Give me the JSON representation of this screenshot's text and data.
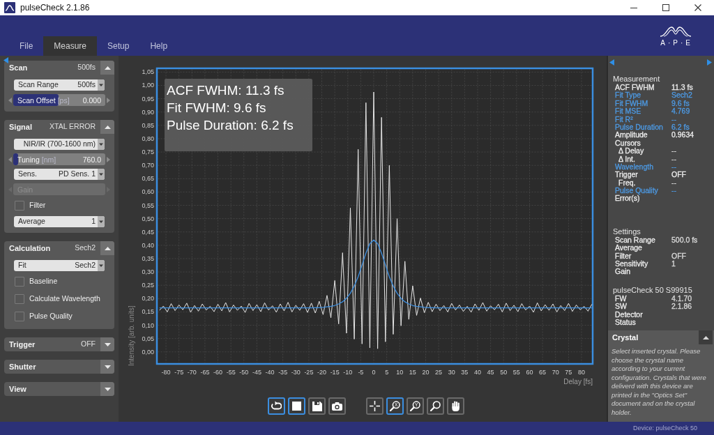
{
  "window": {
    "title": "pulseCheck 2.1.86"
  },
  "menu": [
    {
      "label": "File",
      "selected": false
    },
    {
      "label": "Measure",
      "selected": true
    },
    {
      "label": "Setup",
      "selected": false
    },
    {
      "label": "Help",
      "selected": false
    }
  ],
  "logo": {
    "text": "A·P·E"
  },
  "left_panel": {
    "sections": [
      {
        "title": "Scan",
        "value": "500fs",
        "expanded": true,
        "controls": [
          {
            "kind": "dropdown",
            "label": "Scan Range",
            "value": "500fs"
          },
          {
            "kind": "slider",
            "label": "Scan Offset",
            "unit": "[ps]",
            "value": "0.000",
            "level": 0.49,
            "disabled": false
          }
        ]
      },
      {
        "title": "Signal",
        "value": "XTAL ERROR",
        "expanded": true,
        "controls": [
          {
            "kind": "dropdown",
            "value": "NIR/IR (700-1600 nm)"
          },
          {
            "kind": "slider",
            "label": "Tuning",
            "unit": "[nm]",
            "value": "760.0",
            "level": 0.05,
            "disabled": false
          },
          {
            "kind": "dropdown",
            "label": "Sens.",
            "value": "PD Sens. 1"
          },
          {
            "kind": "slider",
            "label": "Gain",
            "disabled": true
          },
          {
            "kind": "checkbox",
            "label": "Filter",
            "checked": false
          },
          {
            "kind": "dropdown",
            "label": "Average",
            "value": "1"
          }
        ]
      },
      {
        "title": "Calculation",
        "value": "Sech2",
        "expanded": true,
        "controls": [
          {
            "kind": "dropdown",
            "label": "Fit",
            "value": "Sech2"
          },
          {
            "kind": "checkbox",
            "label": "Baseline",
            "checked": false
          },
          {
            "kind": "checkbox",
            "label": "Calculate Wavelength",
            "checked": false
          },
          {
            "kind": "checkbox",
            "label": "Pulse Quality",
            "checked": false
          }
        ]
      },
      {
        "title": "Trigger",
        "value": "OFF",
        "expanded": false
      },
      {
        "title": "Shutter",
        "expanded": false
      },
      {
        "title": "View",
        "expanded": false
      }
    ]
  },
  "plot": {
    "overlay": [
      "ACF FWHM: 11.3 fs",
      "Fit FWHM: 9.6 fs",
      "Pulse Duration: 6.2 fs"
    ],
    "chart_data": {
      "type": "line",
      "xlabel": "Delay [fs]",
      "ylabel": "Intensity [arb. units]",
      "grid": true,
      "xlim": [
        -83.5,
        84.3
      ],
      "ylim": [
        -0.045,
        1.064
      ],
      "xticks": [
        -80,
        -75,
        -70,
        -65,
        -60,
        -55,
        -50,
        -45,
        -40,
        -35,
        -30,
        -25,
        -20,
        -15,
        -10,
        -5,
        0,
        5,
        10,
        15,
        20,
        25,
        30,
        35,
        40,
        45,
        50,
        55,
        60,
        65,
        70,
        75,
        80
      ],
      "yticks": [
        {
          "value": 0,
          "label": "0,00"
        },
        {
          "value": 0.05,
          "label": "0,05"
        },
        {
          "value": 0.1,
          "label": "0,10"
        },
        {
          "value": 0.15,
          "label": "0,15"
        },
        {
          "value": 0.2,
          "label": "0,20"
        },
        {
          "value": 0.25,
          "label": "0,25"
        },
        {
          "value": 0.3,
          "label": "0,30"
        },
        {
          "value": 0.35,
          "label": "0,35"
        },
        {
          "value": 0.4,
          "label": "0,40"
        },
        {
          "value": 0.45,
          "label": "0,45"
        },
        {
          "value": 0.5,
          "label": "0,50"
        },
        {
          "value": 0.55,
          "label": "0,55"
        },
        {
          "value": 0.6,
          "label": "0,60"
        },
        {
          "value": 0.65,
          "label": "0,65"
        },
        {
          "value": 0.7,
          "label": "0,70"
        },
        {
          "value": 0.75,
          "label": "0,75"
        },
        {
          "value": 0.8,
          "label": "0,80"
        },
        {
          "value": 0.85,
          "label": "0,85"
        },
        {
          "value": 0.9,
          "label": "0,90"
        },
        {
          "value": 0.95,
          "label": "0,95"
        },
        {
          "value": 1,
          "label": "1,00"
        },
        {
          "value": 1.05,
          "label": "1,05"
        }
      ],
      "x": [
        -82.5,
        -81,
        -79.5,
        -78,
        -76.5,
        -75,
        -73.5,
        -72,
        -70.5,
        -69,
        -67.5,
        -66,
        -64.5,
        -63,
        -61.5,
        -60,
        -58.5,
        -57,
        -55.5,
        -54,
        -52.5,
        -51,
        -49.5,
        -48,
        -46.5,
        -45,
        -43.5,
        -42,
        -40.5,
        -39,
        -37.5,
        -36,
        -34.5,
        -33,
        -31.5,
        -30,
        -28.5,
        -27,
        -25.5,
        -24,
        -22.5,
        -21,
        -19.5,
        -18,
        -16.5,
        -15,
        -13.5,
        -12,
        -10.5,
        -9,
        -7.5,
        -6,
        -4.5,
        -3,
        -1.5,
        0,
        1.5,
        3,
        4.5,
        6,
        7.5,
        9,
        10.5,
        12,
        13.5,
        15,
        16.5,
        18,
        19.5,
        21,
        22.5,
        24,
        25.5,
        27,
        28.5,
        30,
        31.5,
        33,
        34.5,
        36,
        37.5,
        39,
        40.5,
        42,
        43.5,
        45,
        46.5,
        48,
        49.5,
        51,
        52.5,
        54,
        55.5,
        57,
        58.5,
        60,
        61.5,
        63,
        64.5,
        66,
        67.5,
        69,
        70.5,
        72,
        73.5,
        75,
        76.5,
        78,
        79.5,
        81,
        82.5,
        84
      ],
      "series": [
        {
          "color": "#e6e6e6",
          "values": [
            0.156,
            0.172,
            0.15,
            0.181,
            0.155,
            0.176,
            0.158,
            0.183,
            0.149,
            0.174,
            0.153,
            0.18,
            0.157,
            0.171,
            0.151,
            0.179,
            0.154,
            0.185,
            0.15,
            0.176,
            0.156,
            0.172,
            0.148,
            0.182,
            0.155,
            0.177,
            0.151,
            0.184,
            0.157,
            0.173,
            0.149,
            0.18,
            0.154,
            0.186,
            0.15,
            0.175,
            0.156,
            0.181,
            0.148,
            0.183,
            0.146,
            0.19,
            0.14,
            0.212,
            0.128,
            0.268,
            0.105,
            0.372,
            0.07,
            0.54,
            0.048,
            0.76,
            0.03,
            0.935,
            0.015,
            0.975,
            0.012,
            0.88,
            0.038,
            0.7,
            0.066,
            0.5,
            0.098,
            0.34,
            0.122,
            0.248,
            0.137,
            0.202,
            0.147,
            0.186,
            0.151,
            0.179,
            0.155,
            0.174,
            0.15,
            0.182,
            0.157,
            0.176,
            0.152,
            0.171,
            0.149,
            0.18,
            0.156,
            0.185,
            0.153,
            0.173,
            0.158,
            0.179,
            0.15,
            0.183,
            0.155,
            0.175,
            0.151,
            0.181,
            0.157,
            0.172,
            0.149,
            0.184,
            0.154,
            0.177,
            0.156,
            0.18,
            0.15,
            0.174,
            0.155,
            0.182,
            0.152,
            0.176,
            0.158,
            0.171,
            0.153,
            0.179
          ]
        },
        {
          "color": "#3d8fe0",
          "values": [
            0.165,
            0.165,
            0.165,
            0.165,
            0.165,
            0.165,
            0.165,
            0.165,
            0.165,
            0.165,
            0.165,
            0.165,
            0.165,
            0.165,
            0.165,
            0.165,
            0.165,
            0.165,
            0.165,
            0.165,
            0.165,
            0.165,
            0.165,
            0.165,
            0.165,
            0.165,
            0.165,
            0.165,
            0.165,
            0.165,
            0.165,
            0.165,
            0.165,
            0.165,
            0.165,
            0.165,
            0.165,
            0.165,
            0.165,
            0.165,
            0.166,
            0.166,
            0.167,
            0.169,
            0.171,
            0.174,
            0.18,
            0.188,
            0.201,
            0.22,
            0.247,
            0.282,
            0.326,
            0.371,
            0.406,
            0.42,
            0.406,
            0.371,
            0.326,
            0.282,
            0.247,
            0.22,
            0.201,
            0.188,
            0.18,
            0.174,
            0.171,
            0.169,
            0.167,
            0.166,
            0.166,
            0.165,
            0.165,
            0.165,
            0.165,
            0.165,
            0.165,
            0.165,
            0.165,
            0.165,
            0.165,
            0.165,
            0.165,
            0.165,
            0.165,
            0.165,
            0.165,
            0.165,
            0.165,
            0.165,
            0.165,
            0.165,
            0.165,
            0.165,
            0.165,
            0.165,
            0.165,
            0.165,
            0.165,
            0.165,
            0.165,
            0.165,
            0.165,
            0.165,
            0.165,
            0.165,
            0.165,
            0.165,
            0.165,
            0.165,
            0.165,
            0.165
          ]
        }
      ]
    }
  },
  "toolbar": {
    "groups": [
      [
        {
          "kind": "repeat",
          "selected": true
        },
        {
          "kind": "stop",
          "selected": true
        },
        {
          "kind": "save",
          "selected": false
        },
        {
          "kind": "snapshot",
          "selected": false
        }
      ],
      [
        {
          "kind": "cursor",
          "selected": false
        },
        {
          "kind": "zoom_axis",
          "label": "X",
          "selected": true
        },
        {
          "kind": "zoom_axis",
          "label": "Y",
          "selected": false
        },
        {
          "kind": "zoom",
          "selected": false
        },
        {
          "kind": "pan",
          "selected": false
        }
      ]
    ]
  },
  "info_panel": {
    "groups": [
      {
        "title": "Measurement",
        "rows": [
          {
            "label": "ACF FWHM",
            "value": "11.3 fs",
            "color": "#eeeeee"
          },
          {
            "label": "Fit Type",
            "value": "Sech2",
            "color": "#4d9be6"
          },
          {
            "label": "Fit FWHM",
            "value": "9.6 fs",
            "color": "#4d9be6"
          },
          {
            "label": "Fit MSE",
            "value": "4.769",
            "color": "#4d9be6"
          },
          {
            "label": "Fit R²",
            "value": "--",
            "color": "#4d9be6"
          },
          {
            "label": "Pulse Duration",
            "value": "6.2 fs",
            "color": "#4d9be6"
          },
          {
            "label": "Amplitude",
            "value": "0.9634",
            "color": "#eeeeee"
          },
          {
            "label": "Cursors",
            "color": "#eeeeee",
            "children": [
              {
                "label": "Δ Delay",
                "value": "--"
              },
              {
                "label": "Δ Int.",
                "value": "--"
              }
            ]
          },
          {
            "label": "Wavelength",
            "value": "--",
            "color": "#4d9be6"
          },
          {
            "label": "Trigger",
            "value": "OFF",
            "color": "#eeeeee",
            "children": [
              {
                "label": "Freq.",
                "value": "--"
              }
            ]
          },
          {
            "label": "Pulse Quality",
            "value": "--",
            "color": "#4d9be6"
          },
          {
            "label": "Error(s)",
            "color": "#eeeeee"
          }
        ]
      },
      {
        "title": "Settings",
        "rows": [
          {
            "label": "Scan Range",
            "value": "500.0 fs"
          },
          {
            "label": "Average"
          },
          {
            "label": "Filter",
            "value": "OFF"
          },
          {
            "label": "Sensitivity",
            "value": "1"
          },
          {
            "label": "Gain"
          }
        ]
      },
      {
        "title": "pulseCheck 50 S99915",
        "rows": [
          {
            "label": "FW",
            "value": "4.1.70"
          },
          {
            "label": "SW",
            "value": "2.1.86"
          },
          {
            "label": "Detector"
          },
          {
            "label": "Status"
          }
        ]
      }
    ],
    "crystal": {
      "title": "Crystal",
      "expanded": true,
      "description": "Select inserted crystal. Please choose the crystal name according to your current configuration. Crystals that were deliverd with this device are printed in the \"Optics Set\" document and on the crystal holder."
    }
  },
  "status_bar": {
    "device": "Device: pulseCheck 50"
  }
}
